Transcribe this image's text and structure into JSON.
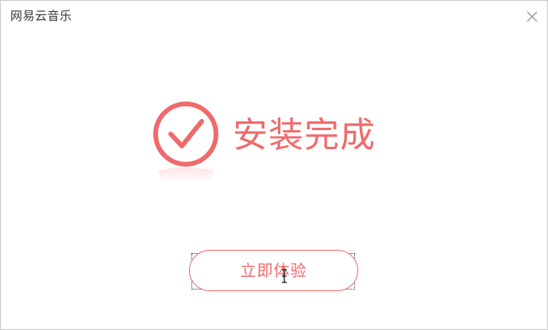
{
  "window": {
    "title": "网易云音乐"
  },
  "status": {
    "headline": "安装完成",
    "icon": "check-circle-icon"
  },
  "actions": {
    "primary_label": "立即体验"
  },
  "colors": {
    "accent": "#f06a6b",
    "title_text": "#333333",
    "close_icon": "#9a9a9a",
    "border": "#c8c8c8"
  }
}
